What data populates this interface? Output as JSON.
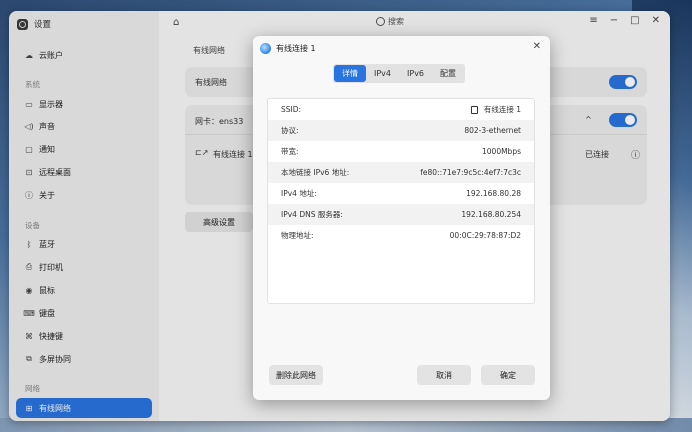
{
  "app": {
    "title": "设置"
  },
  "sidebar": {
    "account": "云账户",
    "system_section": "系统",
    "system_items": [
      "显示器",
      "声音",
      "通知",
      "远程桌面",
      "关于"
    ],
    "device_section": "设备",
    "device_items": [
      "蓝牙",
      "打印机",
      "鼠标",
      "键盘",
      "快捷键",
      "多屏协同"
    ],
    "network_section": "网络",
    "network_items": [
      "有线网络"
    ]
  },
  "main": {
    "search_placeholder": "搜索",
    "section_title": "有线网络",
    "wired_label": "有线网络",
    "nic_label": "网卡：ens33",
    "connection_name": "有线连接 1",
    "connection_status": "已连接",
    "advanced_button": "高级设置"
  },
  "dialog": {
    "title": "有线连接 1",
    "tabs": [
      "详情",
      "IPv4",
      "IPv6",
      "配置"
    ],
    "active_tab": "详情",
    "rows": [
      {
        "key": "SSID:",
        "value": "有线连接 1"
      },
      {
        "key": "协议:",
        "value": "802-3-ethernet"
      },
      {
        "key": "带宽:",
        "value": "1000Mbps"
      },
      {
        "key": "本地链接 IPv6 地址:",
        "value": "fe80::71e7:9c5c:4ef7:7c3c"
      },
      {
        "key": "IPv4 地址:",
        "value": "192.168.80.28"
      },
      {
        "key": "IPv4 DNS 服务器:",
        "value": "192.168.80.254"
      },
      {
        "key": "物理地址:",
        "value": "00:0C:29:78:87:D2"
      }
    ],
    "delete_button": "删除此网络",
    "cancel_button": "取消",
    "confirm_button": "确定"
  },
  "colors": {
    "accent": "#2a74e0"
  }
}
